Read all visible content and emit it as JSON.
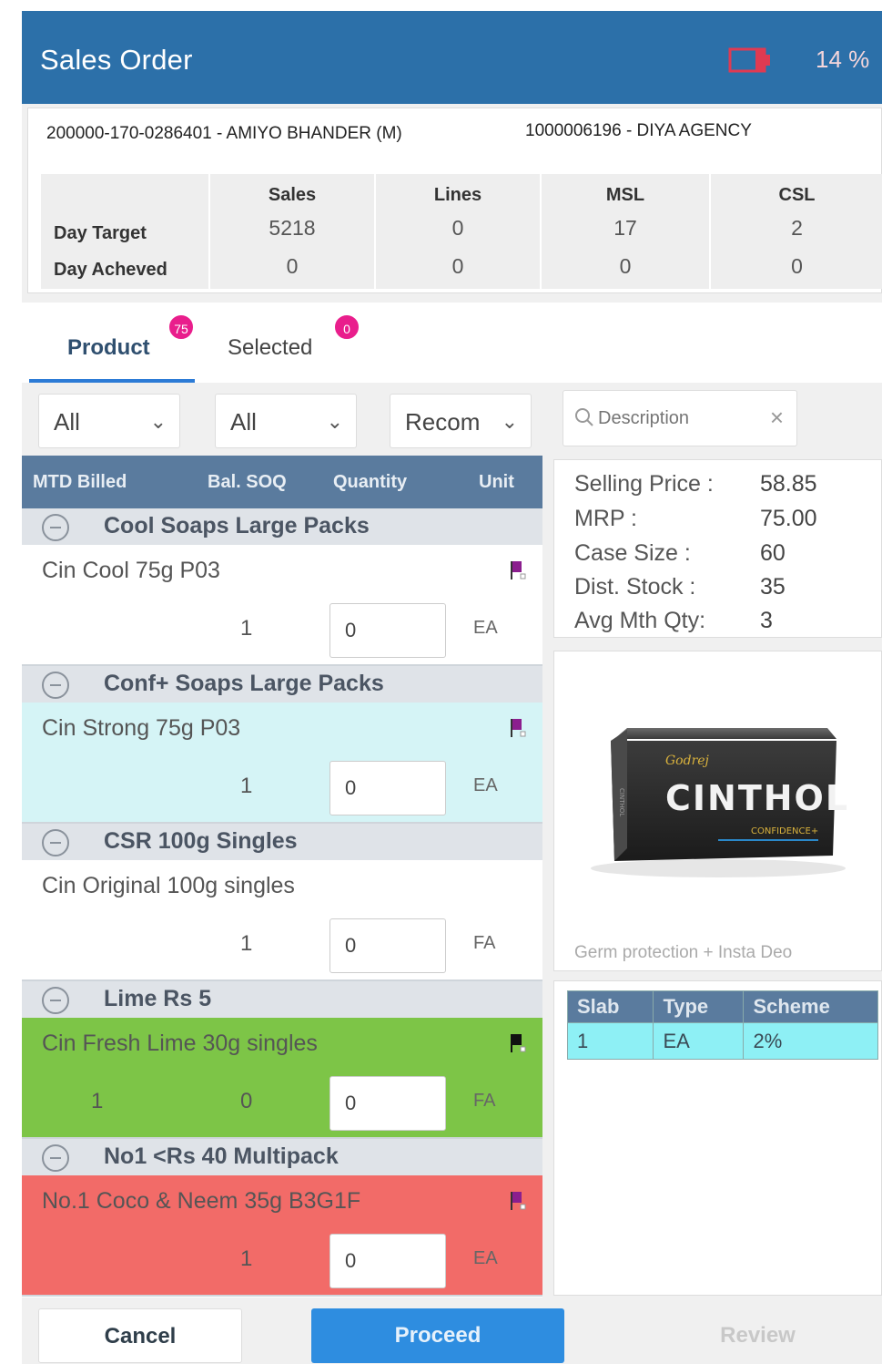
{
  "header": {
    "title": "Sales Order",
    "battery_percent": "14 %",
    "colors": {
      "bar": "#2c70a9",
      "battery": "#e03a52"
    }
  },
  "summary": {
    "customer": "200000-170-0286401 - AMIYO BHANDER (M)",
    "distributor": "1000006196 - DIYA AGENCY",
    "columns": [
      "Sales",
      "Lines",
      "MSL",
      "CSL"
    ],
    "day_target_label": "Day Target",
    "day_achieved_label": "Day Acheved",
    "day_target": [
      "5218",
      "0",
      "17",
      "2"
    ],
    "day_achieved": [
      "0",
      "0",
      "0",
      "0"
    ]
  },
  "tabs": [
    {
      "label": "Product",
      "badge": "75",
      "active": true
    },
    {
      "label": "Selected",
      "badge": "0",
      "active": false
    }
  ],
  "filters": {
    "filter1": "All",
    "filter2": "All",
    "filter3": "Recom",
    "search_placeholder": "Description"
  },
  "list_header": [
    "MTD Billed",
    "Bal. SOQ",
    "Quantity",
    "Unit"
  ],
  "groups": [
    {
      "name": "Cool Soaps Large Packs",
      "item": {
        "name": "Cin Cool 75g P03",
        "mtd": "",
        "bal_soq": "1",
        "qty": "0",
        "unit": "EA",
        "bg": "#ffffff",
        "flag": "purple"
      }
    },
    {
      "name": "Conf+ Soaps Large Packs",
      "item": {
        "name": "Cin Strong 75g P03",
        "mtd": "",
        "bal_soq": "1",
        "qty": "0",
        "unit": "EA",
        "bg": "#d5f4f6",
        "flag": "purple"
      }
    },
    {
      "name": "CSR 100g Singles",
      "item": {
        "name": "Cin Original 100g singles",
        "mtd": "",
        "bal_soq": "1",
        "qty": "0",
        "unit": "FA",
        "bg": "#ffffff",
        "flag": ""
      }
    },
    {
      "name": "Lime Rs 5",
      "item": {
        "name": "Cin Fresh Lime 30g singles",
        "mtd": "1",
        "bal_soq": "0",
        "qty": "0",
        "unit": "FA",
        "bg": "#7dc547",
        "flag": "black"
      }
    },
    {
      "name": "No1 <Rs 40 Multipack",
      "item": {
        "name": "No.1 Coco & Neem 35g B3G1F",
        "mtd": "",
        "bal_soq": "1",
        "qty": "0",
        "unit": "EA",
        "bg": "#f26b68",
        "flag": "purple"
      }
    }
  ],
  "detail": {
    "rows": [
      {
        "label": "Selling Price :",
        "value": "58.85"
      },
      {
        "label": "MRP :",
        "value": "75.00"
      },
      {
        "label": "Case Size :",
        "value": "60"
      },
      {
        "label": "Dist. Stock :",
        "value": "35"
      },
      {
        "label": "Avg Mth Qty:",
        "value": "3"
      }
    ]
  },
  "product_image": {
    "brand_small": "Godrej",
    "brand": "CINTHOL",
    "variant": "CONFIDENCE+",
    "caption": "Germ protection + Insta Deo"
  },
  "schemes": {
    "headers": [
      "Slab",
      "Type",
      "Scheme"
    ],
    "rows": [
      [
        "1",
        "EA",
        "2%"
      ]
    ]
  },
  "buttons": {
    "cancel": "Cancel",
    "proceed": "Proceed",
    "review": "Review"
  }
}
